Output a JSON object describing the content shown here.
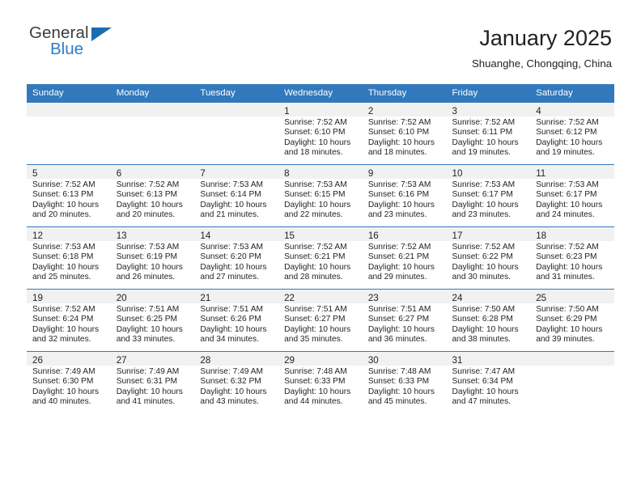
{
  "brand": {
    "name_top": "General",
    "name_bottom": "Blue",
    "triangle_color": "#1b6cb0",
    "blue_color": "#2e7cc4"
  },
  "header": {
    "title": "January 2025",
    "subtitle": "Shuanghe, Chongqing, China"
  },
  "theme": {
    "header_blue": "#3179bc",
    "daynum_band": "#f1f1f1",
    "text": "#231f20"
  },
  "weekday_headers": [
    "Sunday",
    "Monday",
    "Tuesday",
    "Wednesday",
    "Thursday",
    "Friday",
    "Saturday"
  ],
  "weeks": [
    [
      {
        "day": "",
        "sunrise": "",
        "sunset": "",
        "daylight_1": "",
        "daylight_2": ""
      },
      {
        "day": "",
        "sunrise": "",
        "sunset": "",
        "daylight_1": "",
        "daylight_2": ""
      },
      {
        "day": "",
        "sunrise": "",
        "sunset": "",
        "daylight_1": "",
        "daylight_2": ""
      },
      {
        "day": "1",
        "sunrise": "Sunrise: 7:52 AM",
        "sunset": "Sunset: 6:10 PM",
        "daylight_1": "Daylight: 10 hours",
        "daylight_2": "and 18 minutes."
      },
      {
        "day": "2",
        "sunrise": "Sunrise: 7:52 AM",
        "sunset": "Sunset: 6:10 PM",
        "daylight_1": "Daylight: 10 hours",
        "daylight_2": "and 18 minutes."
      },
      {
        "day": "3",
        "sunrise": "Sunrise: 7:52 AM",
        "sunset": "Sunset: 6:11 PM",
        "daylight_1": "Daylight: 10 hours",
        "daylight_2": "and 19 minutes."
      },
      {
        "day": "4",
        "sunrise": "Sunrise: 7:52 AM",
        "sunset": "Sunset: 6:12 PM",
        "daylight_1": "Daylight: 10 hours",
        "daylight_2": "and 19 minutes."
      }
    ],
    [
      {
        "day": "5",
        "sunrise": "Sunrise: 7:52 AM",
        "sunset": "Sunset: 6:13 PM",
        "daylight_1": "Daylight: 10 hours",
        "daylight_2": "and 20 minutes."
      },
      {
        "day": "6",
        "sunrise": "Sunrise: 7:52 AM",
        "sunset": "Sunset: 6:13 PM",
        "daylight_1": "Daylight: 10 hours",
        "daylight_2": "and 20 minutes."
      },
      {
        "day": "7",
        "sunrise": "Sunrise: 7:53 AM",
        "sunset": "Sunset: 6:14 PM",
        "daylight_1": "Daylight: 10 hours",
        "daylight_2": "and 21 minutes."
      },
      {
        "day": "8",
        "sunrise": "Sunrise: 7:53 AM",
        "sunset": "Sunset: 6:15 PM",
        "daylight_1": "Daylight: 10 hours",
        "daylight_2": "and 22 minutes."
      },
      {
        "day": "9",
        "sunrise": "Sunrise: 7:53 AM",
        "sunset": "Sunset: 6:16 PM",
        "daylight_1": "Daylight: 10 hours",
        "daylight_2": "and 23 minutes."
      },
      {
        "day": "10",
        "sunrise": "Sunrise: 7:53 AM",
        "sunset": "Sunset: 6:17 PM",
        "daylight_1": "Daylight: 10 hours",
        "daylight_2": "and 23 minutes."
      },
      {
        "day": "11",
        "sunrise": "Sunrise: 7:53 AM",
        "sunset": "Sunset: 6:17 PM",
        "daylight_1": "Daylight: 10 hours",
        "daylight_2": "and 24 minutes."
      }
    ],
    [
      {
        "day": "12",
        "sunrise": "Sunrise: 7:53 AM",
        "sunset": "Sunset: 6:18 PM",
        "daylight_1": "Daylight: 10 hours",
        "daylight_2": "and 25 minutes."
      },
      {
        "day": "13",
        "sunrise": "Sunrise: 7:53 AM",
        "sunset": "Sunset: 6:19 PM",
        "daylight_1": "Daylight: 10 hours",
        "daylight_2": "and 26 minutes."
      },
      {
        "day": "14",
        "sunrise": "Sunrise: 7:53 AM",
        "sunset": "Sunset: 6:20 PM",
        "daylight_1": "Daylight: 10 hours",
        "daylight_2": "and 27 minutes."
      },
      {
        "day": "15",
        "sunrise": "Sunrise: 7:52 AM",
        "sunset": "Sunset: 6:21 PM",
        "daylight_1": "Daylight: 10 hours",
        "daylight_2": "and 28 minutes."
      },
      {
        "day": "16",
        "sunrise": "Sunrise: 7:52 AM",
        "sunset": "Sunset: 6:21 PM",
        "daylight_1": "Daylight: 10 hours",
        "daylight_2": "and 29 minutes."
      },
      {
        "day": "17",
        "sunrise": "Sunrise: 7:52 AM",
        "sunset": "Sunset: 6:22 PM",
        "daylight_1": "Daylight: 10 hours",
        "daylight_2": "and 30 minutes."
      },
      {
        "day": "18",
        "sunrise": "Sunrise: 7:52 AM",
        "sunset": "Sunset: 6:23 PM",
        "daylight_1": "Daylight: 10 hours",
        "daylight_2": "and 31 minutes."
      }
    ],
    [
      {
        "day": "19",
        "sunrise": "Sunrise: 7:52 AM",
        "sunset": "Sunset: 6:24 PM",
        "daylight_1": "Daylight: 10 hours",
        "daylight_2": "and 32 minutes."
      },
      {
        "day": "20",
        "sunrise": "Sunrise: 7:51 AM",
        "sunset": "Sunset: 6:25 PM",
        "daylight_1": "Daylight: 10 hours",
        "daylight_2": "and 33 minutes."
      },
      {
        "day": "21",
        "sunrise": "Sunrise: 7:51 AM",
        "sunset": "Sunset: 6:26 PM",
        "daylight_1": "Daylight: 10 hours",
        "daylight_2": "and 34 minutes."
      },
      {
        "day": "22",
        "sunrise": "Sunrise: 7:51 AM",
        "sunset": "Sunset: 6:27 PM",
        "daylight_1": "Daylight: 10 hours",
        "daylight_2": "and 35 minutes."
      },
      {
        "day": "23",
        "sunrise": "Sunrise: 7:51 AM",
        "sunset": "Sunset: 6:27 PM",
        "daylight_1": "Daylight: 10 hours",
        "daylight_2": "and 36 minutes."
      },
      {
        "day": "24",
        "sunrise": "Sunrise: 7:50 AM",
        "sunset": "Sunset: 6:28 PM",
        "daylight_1": "Daylight: 10 hours",
        "daylight_2": "and 38 minutes."
      },
      {
        "day": "25",
        "sunrise": "Sunrise: 7:50 AM",
        "sunset": "Sunset: 6:29 PM",
        "daylight_1": "Daylight: 10 hours",
        "daylight_2": "and 39 minutes."
      }
    ],
    [
      {
        "day": "26",
        "sunrise": "Sunrise: 7:49 AM",
        "sunset": "Sunset: 6:30 PM",
        "daylight_1": "Daylight: 10 hours",
        "daylight_2": "and 40 minutes."
      },
      {
        "day": "27",
        "sunrise": "Sunrise: 7:49 AM",
        "sunset": "Sunset: 6:31 PM",
        "daylight_1": "Daylight: 10 hours",
        "daylight_2": "and 41 minutes."
      },
      {
        "day": "28",
        "sunrise": "Sunrise: 7:49 AM",
        "sunset": "Sunset: 6:32 PM",
        "daylight_1": "Daylight: 10 hours",
        "daylight_2": "and 43 minutes."
      },
      {
        "day": "29",
        "sunrise": "Sunrise: 7:48 AM",
        "sunset": "Sunset: 6:33 PM",
        "daylight_1": "Daylight: 10 hours",
        "daylight_2": "and 44 minutes."
      },
      {
        "day": "30",
        "sunrise": "Sunrise: 7:48 AM",
        "sunset": "Sunset: 6:33 PM",
        "daylight_1": "Daylight: 10 hours",
        "daylight_2": "and 45 minutes."
      },
      {
        "day": "31",
        "sunrise": "Sunrise: 7:47 AM",
        "sunset": "Sunset: 6:34 PM",
        "daylight_1": "Daylight: 10 hours",
        "daylight_2": "and 47 minutes."
      },
      {
        "day": "",
        "sunrise": "",
        "sunset": "",
        "daylight_1": "",
        "daylight_2": ""
      }
    ]
  ]
}
